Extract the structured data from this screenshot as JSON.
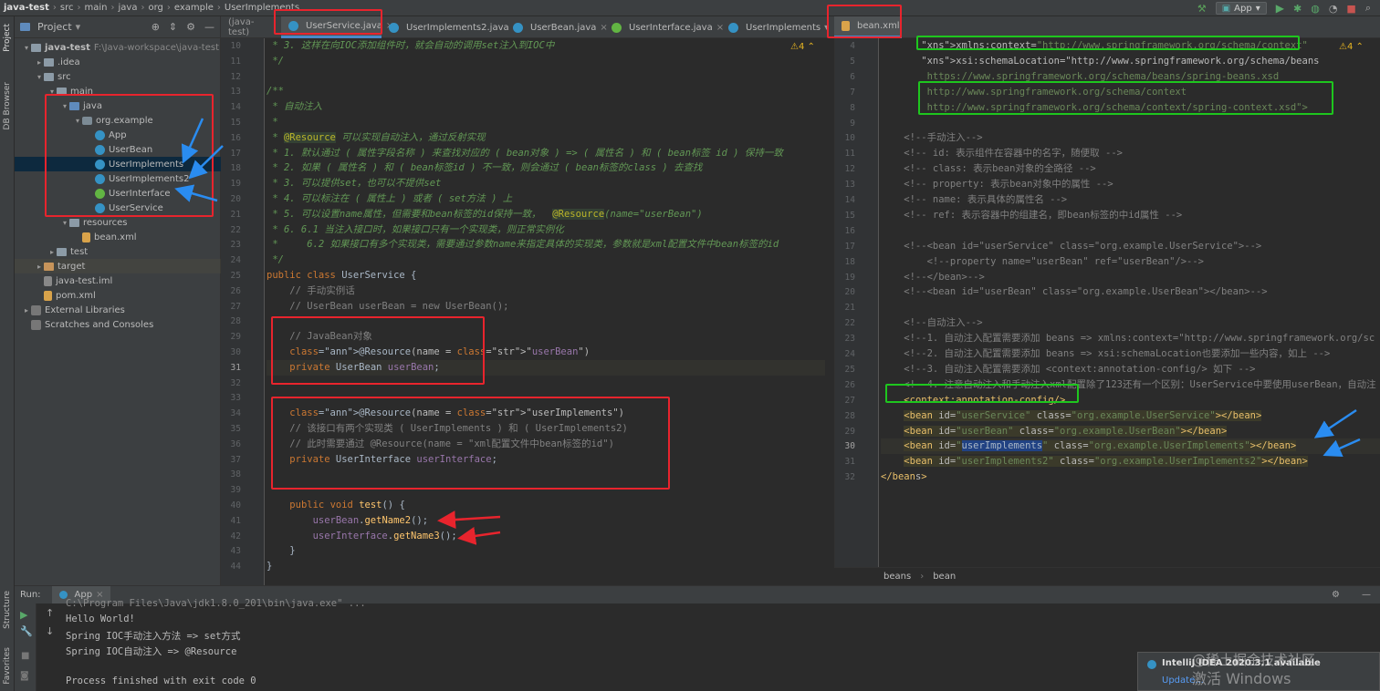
{
  "breadcrumb": [
    "java-test",
    "src",
    "main",
    "java",
    "org",
    "example",
    "UserImplements"
  ],
  "run_config": "App",
  "left_strip": {
    "project": "Project",
    "db_browser": "DB Browser",
    "structure": "Structure",
    "favorites": "Favorites"
  },
  "project_panel": {
    "title": "Project",
    "tree": [
      {
        "label": "java-test",
        "hint": "F:\\Java-workspace\\java-test",
        "indent": 0,
        "icon": "folder",
        "arrow": "down"
      },
      {
        "label": ".idea",
        "indent": 1,
        "icon": "folder",
        "arrow": "right"
      },
      {
        "label": "src",
        "indent": 1,
        "icon": "folder",
        "arrow": "down"
      },
      {
        "label": "main",
        "indent": 2,
        "icon": "folder",
        "arrow": "down"
      },
      {
        "label": "java",
        "indent": 3,
        "icon": "folder-blue",
        "arrow": "down"
      },
      {
        "label": "org.example",
        "indent": 4,
        "icon": "pkg",
        "arrow": "down"
      },
      {
        "label": "App",
        "indent": 5,
        "icon": "cls",
        "arrow": ""
      },
      {
        "label": "UserBean",
        "indent": 5,
        "icon": "cls",
        "arrow": ""
      },
      {
        "label": "UserImplements",
        "indent": 5,
        "icon": "cls",
        "arrow": "",
        "selected": true
      },
      {
        "label": "UserImplements2",
        "indent": 5,
        "icon": "cls",
        "arrow": ""
      },
      {
        "label": "UserInterface",
        "indent": 5,
        "icon": "iface",
        "arrow": ""
      },
      {
        "label": "UserService",
        "indent": 5,
        "icon": "cls",
        "arrow": ""
      },
      {
        "label": "resources",
        "indent": 3,
        "icon": "folder",
        "arrow": "down"
      },
      {
        "label": "bean.xml",
        "indent": 4,
        "icon": "xml",
        "arrow": ""
      },
      {
        "label": "test",
        "indent": 2,
        "icon": "folder",
        "arrow": "right"
      },
      {
        "label": "target",
        "indent": 1,
        "icon": "folder-orange",
        "arrow": "right",
        "yellow": true
      },
      {
        "label": "java-test.iml",
        "indent": 1,
        "icon": "iml",
        "arrow": ""
      },
      {
        "label": "pom.xml",
        "indent": 1,
        "icon": "xml",
        "arrow": ""
      },
      {
        "label": "External Libraries",
        "indent": 0,
        "icon": "lib",
        "arrow": "right"
      },
      {
        "label": "Scratches and Consoles",
        "indent": 0,
        "icon": "lib",
        "arrow": ""
      }
    ]
  },
  "tabs": {
    "overflow": "(java-test)",
    "items": [
      {
        "label": "UserService.java",
        "active": true
      },
      {
        "label": "UserImplements2.java"
      },
      {
        "label": "UserBean.java"
      },
      {
        "label": "UserInterface.java"
      },
      {
        "label": "UserImplements"
      },
      {
        "label": "bean.xml",
        "active": true
      }
    ]
  },
  "left_editor": {
    "warnings": "4",
    "lines": [
      {
        "n": "10",
        "t": " * 3. 这样在向IOC添加组件时，就会自动的调用set注入到IOC中"
      },
      {
        "n": "11",
        "t": " */"
      },
      {
        "n": "12",
        "t": ""
      },
      {
        "n": "13",
        "t": "/**"
      },
      {
        "n": "14",
        "t": " * 自动注入"
      },
      {
        "n": "15",
        "t": " *"
      },
      {
        "n": "16",
        "t": " * @Resource 可以实现自动注入，通过反射实现"
      },
      {
        "n": "17",
        "t": " * 1. 默认通过 ( 属性字段名称 ) 来查找对应的 ( bean对象 ) => ( 属性名 ) 和 ( bean标签 id ) 保持一致"
      },
      {
        "n": "18",
        "t": " * 2. 如果 ( 属性名 ) 和 ( bean标签id ) 不一致，则会通过 ( bean标签的class ) 去查找"
      },
      {
        "n": "19",
        "t": " * 3. 可以提供set，也可以不提供set"
      },
      {
        "n": "20",
        "t": " * 4. 可以标注在 ( 属性上 ) 或者 ( set方法 ) 上"
      },
      {
        "n": "21",
        "t": " * 5. 可以设置name属性，但需要和bean标签的id保持一致，  @Resource(name=\"userBean\")"
      },
      {
        "n": "22",
        "t": " * 6. 6.1 当注入接口时，如果接口只有一个实现类，则正常实例化"
      },
      {
        "n": "23",
        "t": " *     6.2 如果接口有多个实现类，需要通过参数name来指定具体的实现类，参数就是xml配置文件中bean标签的id"
      },
      {
        "n": "24",
        "t": " */"
      },
      {
        "n": "25",
        "t": "public class UserService {"
      },
      {
        "n": "26",
        "t": "    // 手动实例话"
      },
      {
        "n": "27",
        "t": "    // UserBean userBean = new UserBean();"
      },
      {
        "n": "28",
        "t": ""
      },
      {
        "n": "29",
        "t": "    // JavaBean对象"
      },
      {
        "n": "30",
        "t": "    @Resource(name = \"userBean\")"
      },
      {
        "n": "31",
        "t": "    private UserBean userBean;"
      },
      {
        "n": "32",
        "t": ""
      },
      {
        "n": "33",
        "t": ""
      },
      {
        "n": "34",
        "t": "    @Resource(name = \"userImplements\")"
      },
      {
        "n": "35",
        "t": "    // 该接口有两个实现类 ( UserImplements ) 和 ( UserImplements2)"
      },
      {
        "n": "36",
        "t": "    // 此时需要通过 @Resource(name = \"xml配置文件中bean标签的id\")"
      },
      {
        "n": "37",
        "t": "    private UserInterface userInterface;"
      },
      {
        "n": "38",
        "t": ""
      },
      {
        "n": "39",
        "t": ""
      },
      {
        "n": "40",
        "t": "    public void test() {"
      },
      {
        "n": "41",
        "t": "        userBean.getName2();"
      },
      {
        "n": "42",
        "t": "        userInterface.getName3();"
      },
      {
        "n": "43",
        "t": "    }"
      },
      {
        "n": "44",
        "t": "}"
      }
    ]
  },
  "right_editor": {
    "warnings": "4",
    "lines": [
      {
        "n": "4",
        "t": "       xmlns:context=\"http://www.springframework.org/schema/context\""
      },
      {
        "n": "5",
        "t": "       xsi:schemaLocation=\"http://www.springframework.org/schema/beans"
      },
      {
        "n": "6",
        "t": "        https://www.springframework.org/schema/beans/spring-beans.xsd"
      },
      {
        "n": "7",
        "t": "        http://www.springframework.org/schema/context"
      },
      {
        "n": "8",
        "t": "        http://www.springframework.org/schema/context/spring-context.xsd\">"
      },
      {
        "n": "9",
        "t": ""
      },
      {
        "n": "10",
        "t": "    <!--手动注入-->"
      },
      {
        "n": "11",
        "t": "    <!-- id: 表示组件在容器中的名字，随便取 -->"
      },
      {
        "n": "12",
        "t": "    <!-- class: 表示bean对象的全路径 -->"
      },
      {
        "n": "13",
        "t": "    <!-- property: 表示bean对象中的属性 -->"
      },
      {
        "n": "14",
        "t": "    <!-- name: 表示具体的属性名 -->"
      },
      {
        "n": "15",
        "t": "    <!-- ref: 表示容器中的组建名，即bean标签的中id属性 -->"
      },
      {
        "n": "16",
        "t": ""
      },
      {
        "n": "17",
        "t": "    <!--<bean id=\"userService\" class=\"org.example.UserService\">-->"
      },
      {
        "n": "18",
        "t": "        <!--property name=\"userBean\" ref=\"userBean\"/>-->"
      },
      {
        "n": "19",
        "t": "    <!--</bean>-->"
      },
      {
        "n": "20",
        "t": "    <!--<bean id=\"userBean\" class=\"org.example.UserBean\"></bean>-->"
      },
      {
        "n": "21",
        "t": ""
      },
      {
        "n": "22",
        "t": "    <!--自动注入-->"
      },
      {
        "n": "23",
        "t": "    <!--1. 自动注入配置需要添加 beans => xmlns:context=\"http://www.springframework.org/sc"
      },
      {
        "n": "24",
        "t": "    <!--2. 自动注入配置需要添加 beans => xsi:schemaLocation也要添加一些内容，如上 -->"
      },
      {
        "n": "25",
        "t": "    <!--3. 自动注入配置需要添加 <context:annotation-config/> 如下 -->"
      },
      {
        "n": "26",
        "t": "    <!--4. 注意自动注入和手动注入xml配置除了123还有一个区别：UserService中要使用userBean，自动注"
      },
      {
        "n": "27",
        "t": "    <context:annotation-config/>"
      },
      {
        "n": "28",
        "t": "    <bean id=\"userService\" class=\"org.example.UserService\"></bean>"
      },
      {
        "n": "29",
        "t": "    <bean id=\"userBean\" class=\"org.example.UserBean\"></bean>"
      },
      {
        "n": "30",
        "t": "    <bean id=\"userImplements\" class=\"org.example.UserImplements\"></bean>"
      },
      {
        "n": "31",
        "t": "    <bean id=\"userImplements2\" class=\"org.example.UserImplements2\"></bean>"
      },
      {
        "n": "32",
        "t": "</beans>"
      }
    ],
    "breadcrumb": [
      "beans",
      "bean"
    ]
  },
  "run_panel": {
    "label": "Run:",
    "tab": "App",
    "output": [
      "C:\\Program Files\\Java\\jdk1.8.0_201\\bin\\java.exe\" ...",
      "Hello World!",
      "Spring IOC手动注入方法 => set方式",
      "Spring IOC自动注入 => @Resource",
      "",
      "Process finished with exit code 0"
    ]
  },
  "notification": {
    "title": "IntelliJ IDEA 2020.3.1 available",
    "link": "Update..."
  },
  "watermark": {
    "line1": "@稀土掘金技术社区",
    "line2": "激活 Windows"
  },
  "colors": {
    "annotation_red": "#e8242d",
    "annotation_green": "#1ec61e",
    "arrow_blue": "#2a8cf0",
    "selection": "#0d293e"
  }
}
